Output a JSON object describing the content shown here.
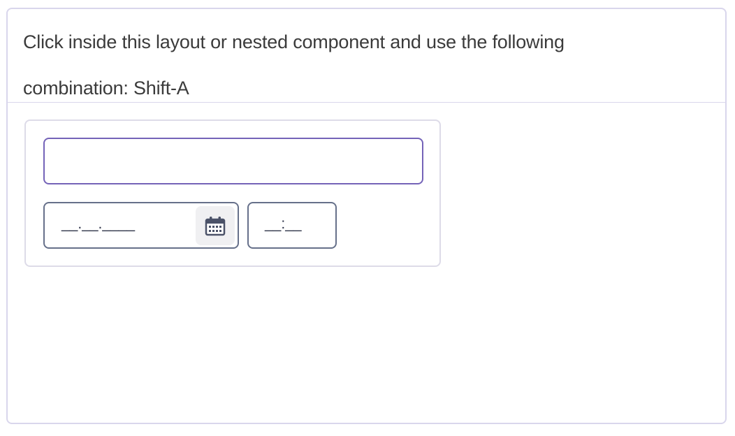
{
  "panel": {
    "instruction": "Click inside this layout or nested component and use the following combination: Shift-A"
  },
  "form": {
    "text_input": {
      "value": "",
      "placeholder": ""
    },
    "date_picker": {
      "mask": "__.__.____",
      "calendar_icon": "calendar-icon"
    },
    "time_picker": {
      "mask": "__:__"
    }
  },
  "colors": {
    "focus_border": "#7463b8",
    "field_border": "#66708a",
    "panel_border": "#d9d6ec",
    "text": "#3b3b3b"
  }
}
